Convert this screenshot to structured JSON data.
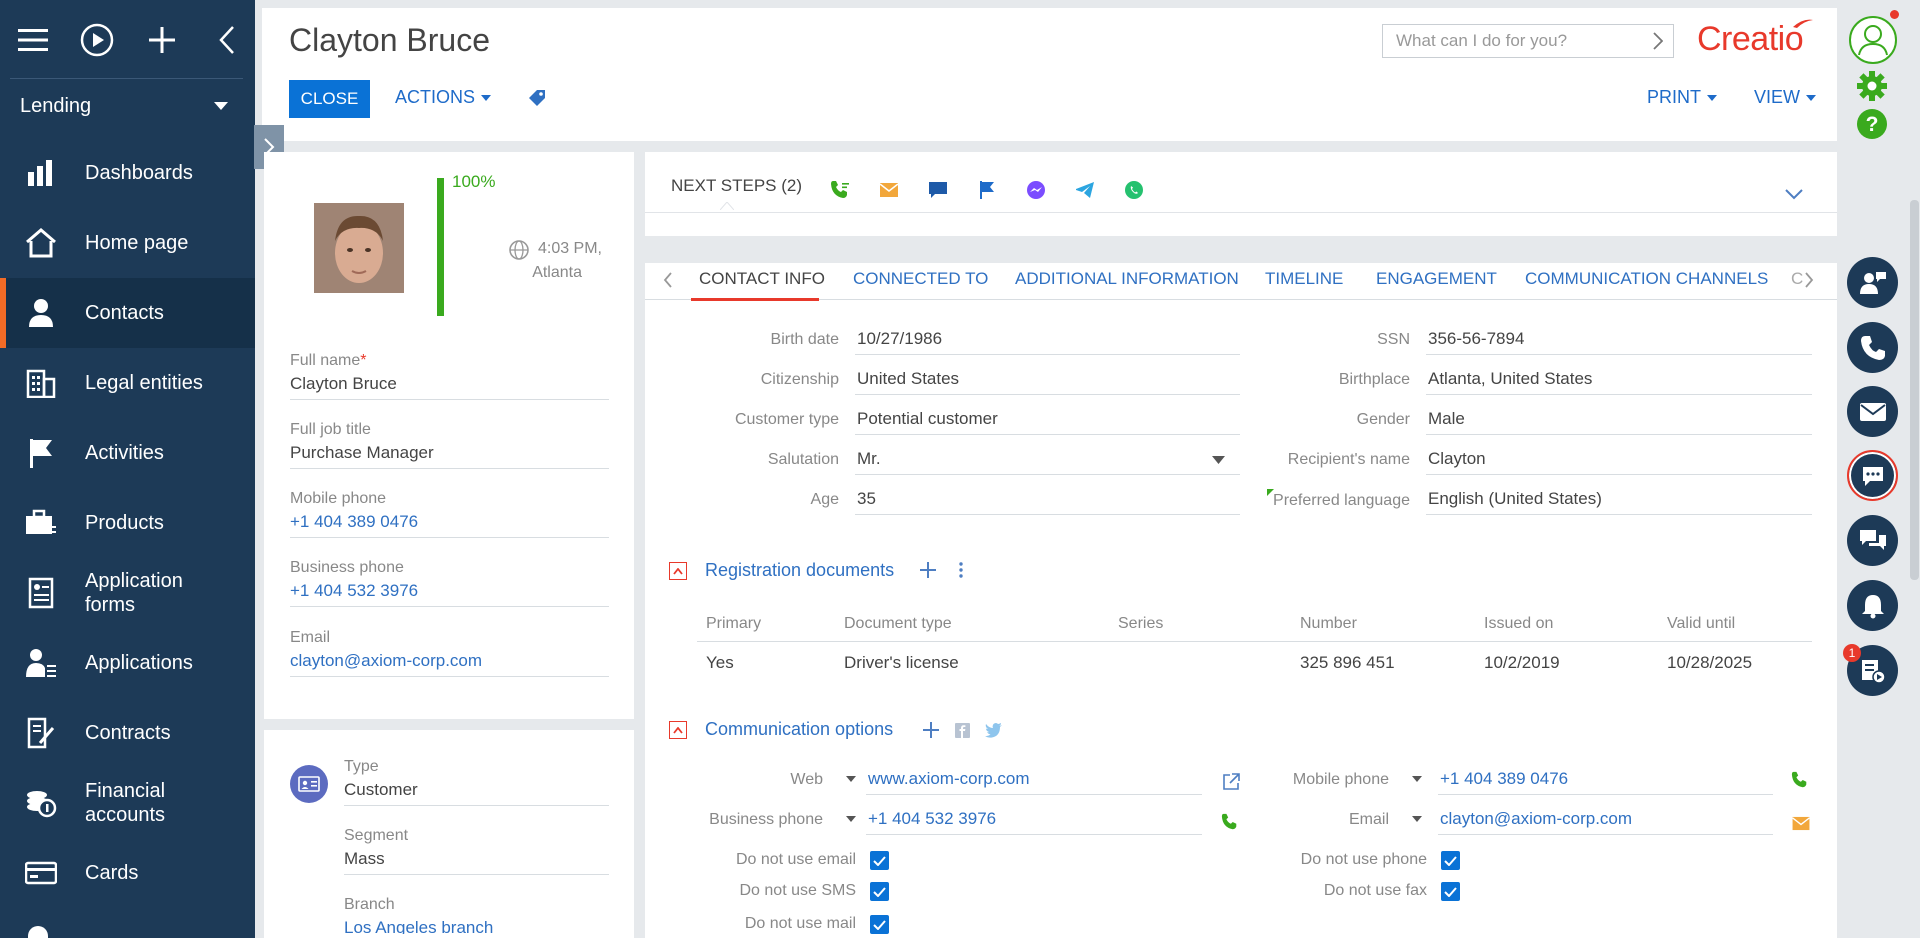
{
  "sidebar": {
    "workspace": "Lending",
    "items": [
      {
        "label": "Dashboards",
        "icon": "dashboards-icon"
      },
      {
        "label": "Home page",
        "icon": "home-icon"
      },
      {
        "label": "Contacts",
        "icon": "contact-icon"
      },
      {
        "label": "Legal entities",
        "icon": "building-icon"
      },
      {
        "label": "Activities",
        "icon": "flag-icon"
      },
      {
        "label": "Products",
        "icon": "products-icon"
      },
      {
        "label": "Application forms",
        "icon": "form-icon"
      },
      {
        "label": "Applications",
        "icon": "applications-icon"
      },
      {
        "label": "Contracts",
        "icon": "contract-icon"
      },
      {
        "label": "Financial accounts",
        "icon": "coins-icon"
      },
      {
        "label": "Cards",
        "icon": "card-icon"
      }
    ],
    "active": "Contacts"
  },
  "header": {
    "title": "Clayton Bruce",
    "close_label": "CLOSE",
    "actions_label": "ACTIONS",
    "print_label": "PRINT",
    "view_label": "VIEW",
    "search_placeholder": "What can I do for you?",
    "logo_text": "Creatio"
  },
  "profile": {
    "completeness": "100%",
    "time": "4:03 PM,",
    "city": "Atlanta",
    "fields": [
      {
        "label": "Full name",
        "value": "Clayton Bruce",
        "required": true,
        "link": false
      },
      {
        "label": "Full job title",
        "value": "Purchase Manager",
        "link": false
      },
      {
        "label": "Mobile phone",
        "value": "+1 404 389 0476",
        "link": true
      },
      {
        "label": "Business phone",
        "value": "+1 404 532 3976",
        "link": true
      },
      {
        "label": "Email",
        "value": "clayton@axiom-corp.com",
        "link": true
      }
    ],
    "required_mark": "*"
  },
  "classification": {
    "fields": [
      {
        "label": "Type",
        "value": "Customer"
      },
      {
        "label": "Segment",
        "value": "Mass"
      },
      {
        "label": "Branch",
        "value": "Los Angeles branch"
      }
    ]
  },
  "next_steps": {
    "title": "NEXT STEPS (2)"
  },
  "tabs": [
    "CONTACT INFO",
    "CONNECTED TO",
    "ADDITIONAL INFORMATION",
    "TIMELINE",
    "ENGAGEMENT",
    "COMMUNICATION CHANNELS",
    "C"
  ],
  "contact_info": {
    "left": [
      {
        "label": "Birth date",
        "value": "10/27/1986"
      },
      {
        "label": "Citizenship",
        "value": "United States"
      },
      {
        "label": "Customer type",
        "value": "Potential customer"
      },
      {
        "label": "Salutation",
        "value": "Mr."
      },
      {
        "label": "Age",
        "value": "35"
      }
    ],
    "right": [
      {
        "label": "SSN",
        "value": "356-56-7894"
      },
      {
        "label": "Birthplace",
        "value": "Atlanta, United States"
      },
      {
        "label": "Gender",
        "value": "Male"
      },
      {
        "label": "Recipient's name",
        "value": "Clayton"
      },
      {
        "label": "Preferred language",
        "value": "English (United States)"
      }
    ]
  },
  "registration": {
    "title": "Registration documents",
    "columns": [
      "Primary",
      "Document type",
      "Series",
      "Number",
      "Issued on",
      "Valid until"
    ],
    "rows": [
      [
        "Yes",
        "Driver's license",
        "",
        "325 896 451",
        "10/2/2019",
        "10/28/2025"
      ]
    ]
  },
  "communication": {
    "title": "Communication options",
    "web_label": "Web",
    "web_value": "www.axiom-corp.com",
    "business_phone_label": "Business phone",
    "business_phone_value": "+1 404 532 3976",
    "mobile_phone_label": "Mobile phone",
    "mobile_phone_value": "+1 404 389 0476",
    "email_label": "Email",
    "email_value": "clayton@axiom-corp.com",
    "checks_left": [
      "Do not use email",
      "Do not use SMS",
      "Do not use mail"
    ],
    "checks_right": [
      "Do not use phone",
      "Do not use fax"
    ]
  },
  "notifications_count": "1",
  "colors": {
    "sidebar": "#1d3a57",
    "accent": "#0a72d6",
    "brand": "#e8392b",
    "active_marker": "#f26b26",
    "progress": "#3aaa1e"
  }
}
